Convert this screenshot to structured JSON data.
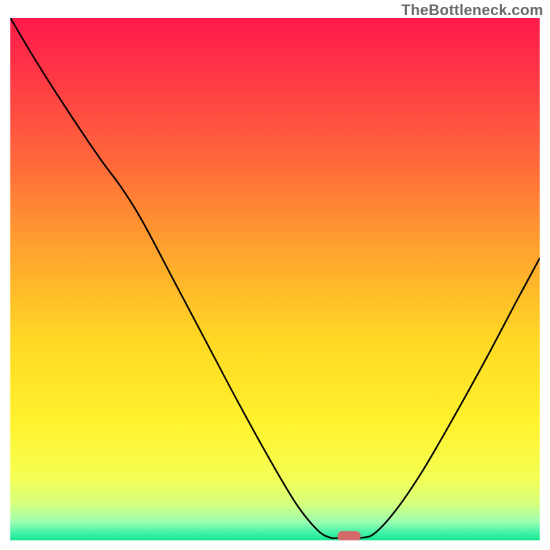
{
  "attribution": "TheBottleneck.com",
  "chart_data": {
    "type": "line",
    "title": "",
    "xlabel": "",
    "ylabel": "",
    "xlim": [
      0,
      100
    ],
    "ylim": [
      0,
      100
    ],
    "gradient_stops": [
      {
        "offset": 0.0,
        "color": "#ff1a4a"
      },
      {
        "offset": 0.12,
        "color": "#ff3a45"
      },
      {
        "offset": 0.28,
        "color": "#ff6a3a"
      },
      {
        "offset": 0.45,
        "color": "#ffa52d"
      },
      {
        "offset": 0.62,
        "color": "#ffd924"
      },
      {
        "offset": 0.78,
        "color": "#fff32e"
      },
      {
        "offset": 0.88,
        "color": "#f4ff54"
      },
      {
        "offset": 0.93,
        "color": "#d6ff7d"
      },
      {
        "offset": 0.965,
        "color": "#9cffb0"
      },
      {
        "offset": 0.985,
        "color": "#44f2a8"
      },
      {
        "offset": 1.0,
        "color": "#14e58f"
      }
    ],
    "curve": [
      {
        "x": 0.0,
        "y": 100.0
      },
      {
        "x": 5.0,
        "y": 91.5
      },
      {
        "x": 11.0,
        "y": 82.0
      },
      {
        "x": 17.0,
        "y": 73.0
      },
      {
        "x": 21.0,
        "y": 67.5
      },
      {
        "x": 25.0,
        "y": 61.0
      },
      {
        "x": 31.0,
        "y": 49.5
      },
      {
        "x": 37.0,
        "y": 38.0
      },
      {
        "x": 43.0,
        "y": 26.5
      },
      {
        "x": 49.0,
        "y": 15.5
      },
      {
        "x": 54.0,
        "y": 7.0
      },
      {
        "x": 58.0,
        "y": 2.0
      },
      {
        "x": 60.5,
        "y": 0.5
      },
      {
        "x": 62.5,
        "y": 0.5
      },
      {
        "x": 66.5,
        "y": 0.5
      },
      {
        "x": 69.0,
        "y": 1.5
      },
      {
        "x": 73.0,
        "y": 6.0
      },
      {
        "x": 78.0,
        "y": 13.5
      },
      {
        "x": 84.0,
        "y": 24.0
      },
      {
        "x": 90.0,
        "y": 35.0
      },
      {
        "x": 96.0,
        "y": 46.5
      },
      {
        "x": 100.0,
        "y": 54.0
      }
    ],
    "marker": {
      "x": 64.0,
      "y": 0.8,
      "rx": 2.2,
      "ry": 1.0,
      "color": "#d46a6a"
    }
  }
}
